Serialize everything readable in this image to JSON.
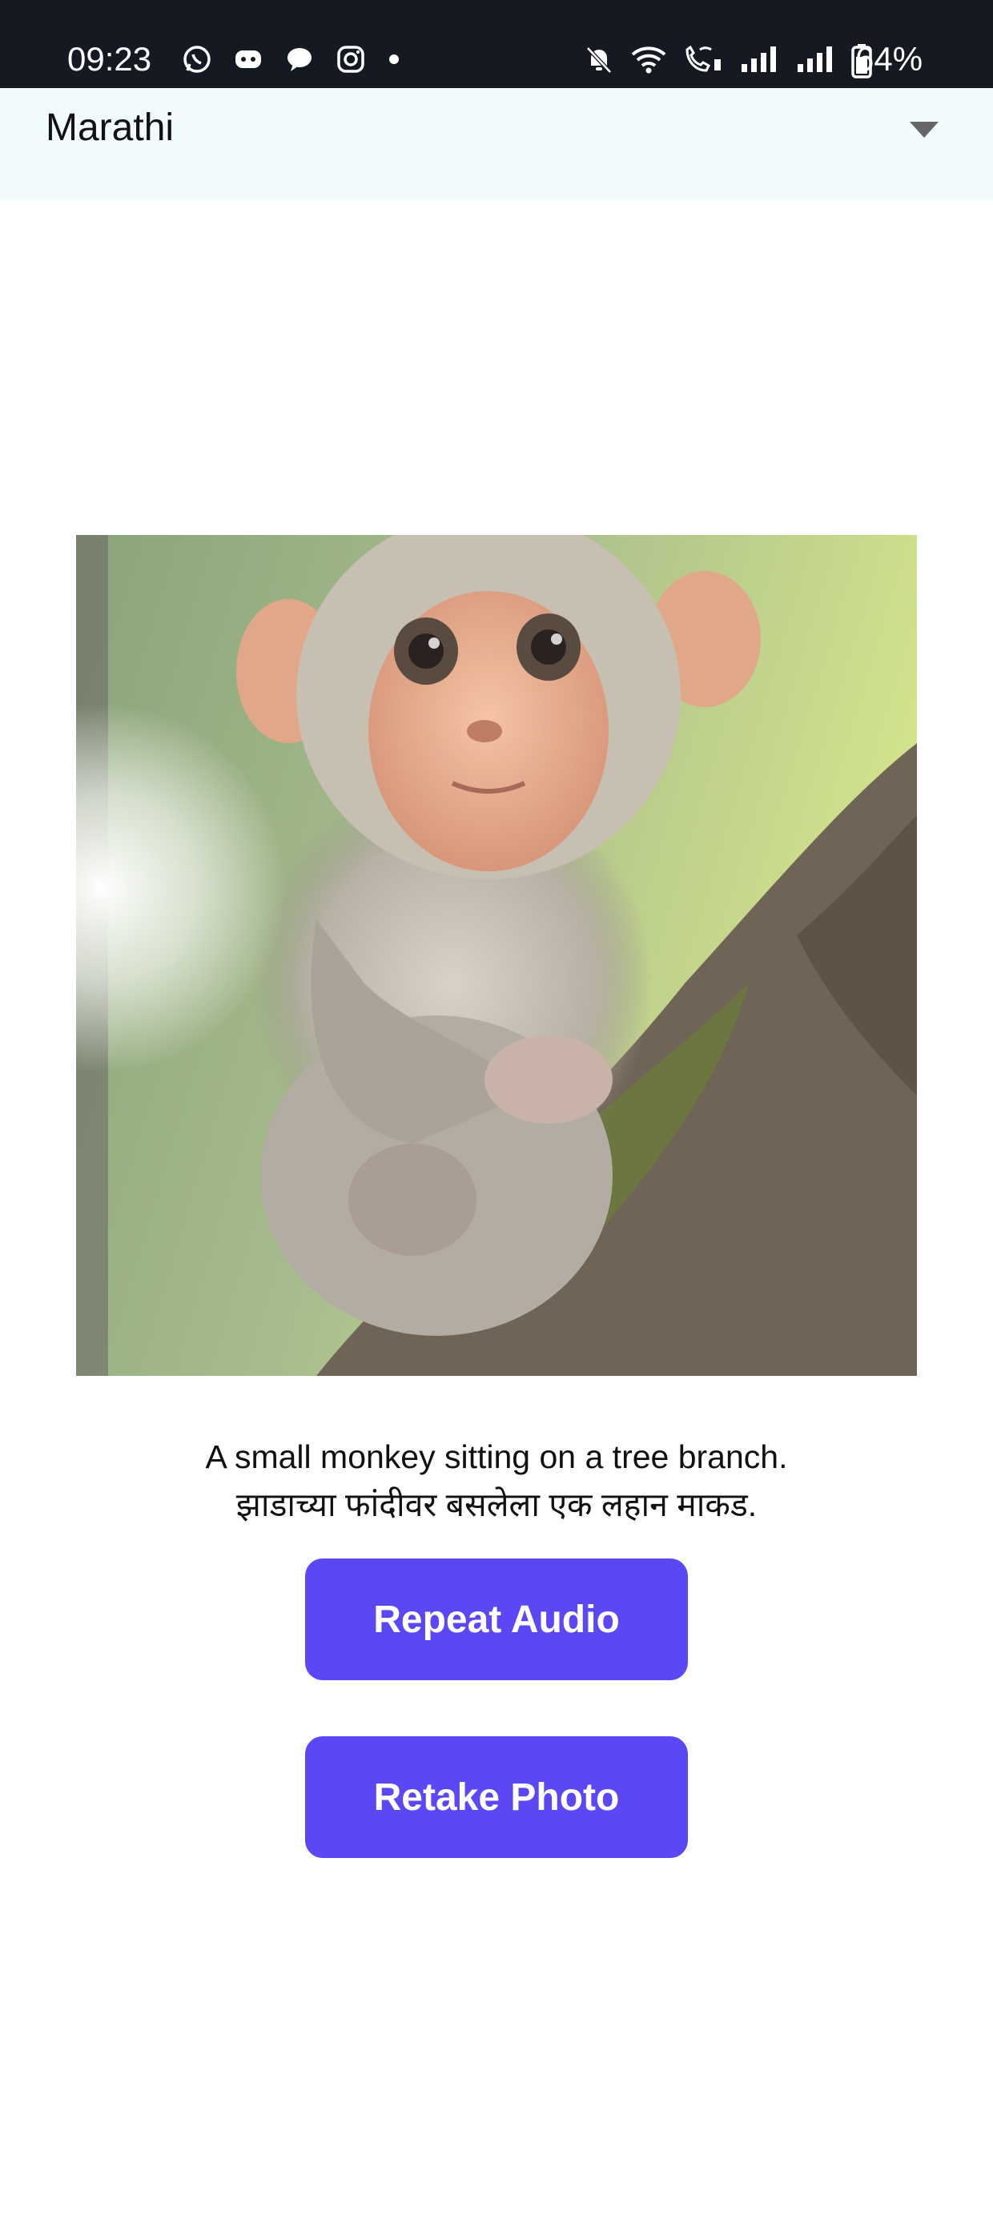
{
  "status_bar": {
    "time": "09:23",
    "left_icons": [
      "whatsapp-icon",
      "discord-icon",
      "chat-bubble-icon",
      "instagram-icon",
      "dot-icon"
    ],
    "right_icons": [
      "mute-bell-icon",
      "wifi-icon",
      "wifi-calling-icon",
      "signal-icon",
      "signal-icon",
      "battery-icon"
    ],
    "battery_percent": "64%"
  },
  "language_selector": {
    "selected": "Marathi",
    "caret_icon": "dropdown-caret-icon"
  },
  "photo": {
    "subject": "monkey-photo"
  },
  "caption": {
    "english": "A small monkey sitting on a tree branch.",
    "marathi": "झाडाच्या फांदीवर बसलेला एक लहान माकड."
  },
  "buttons": {
    "repeat_audio": "Repeat Audio",
    "retake_photo": "Retake Photo"
  },
  "colors": {
    "status_bar_bg": "#151a22",
    "dropdown_bg": "#f1fbfd",
    "button_bg": "#5a48f5",
    "button_text": "#ffffff"
  }
}
